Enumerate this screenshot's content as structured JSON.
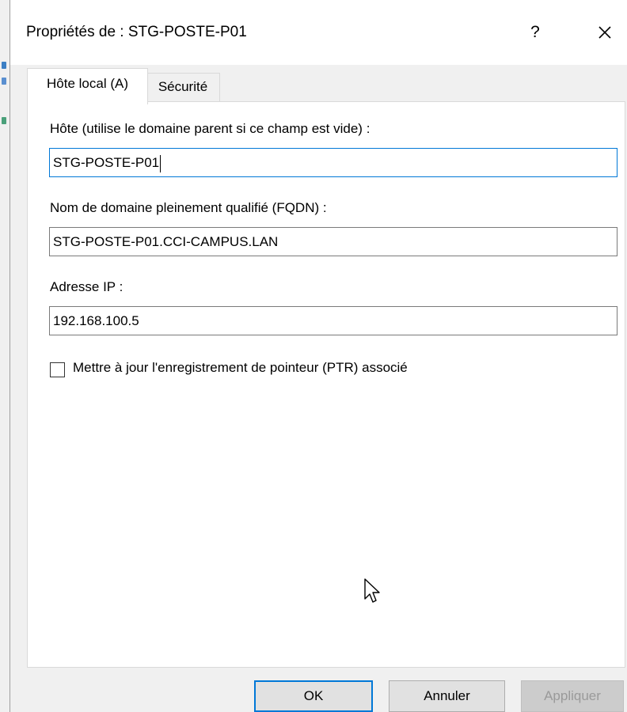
{
  "window": {
    "title": "Propriétés de : STG-POSTE-P01",
    "help_label": "?",
    "close_icon": "close-icon"
  },
  "tabs": [
    {
      "label": "Hôte local (A)",
      "active": true
    },
    {
      "label": "Sécurité",
      "active": false
    }
  ],
  "host_field": {
    "label": "Hôte (utilise le domaine parent si ce champ est vide) :",
    "value": "STG-POSTE-P01"
  },
  "fqdn_field": {
    "label": "Nom de domaine pleinement qualifié (FQDN) :",
    "value": "STG-POSTE-P01.CCI-CAMPUS.LAN"
  },
  "ip_field": {
    "label": "Adresse IP :",
    "value": "192.168.100.5"
  },
  "ptr_checkbox": {
    "label": "Mettre à jour l'enregistrement de pointeur (PTR) associé",
    "checked": false
  },
  "buttons": {
    "ok": "OK",
    "cancel": "Annuler",
    "apply": "Appliquer"
  },
  "colors": {
    "focus_accent": "#0078d7",
    "dialog_bg": "#f0f0f0",
    "panel_bg": "#ffffff"
  }
}
